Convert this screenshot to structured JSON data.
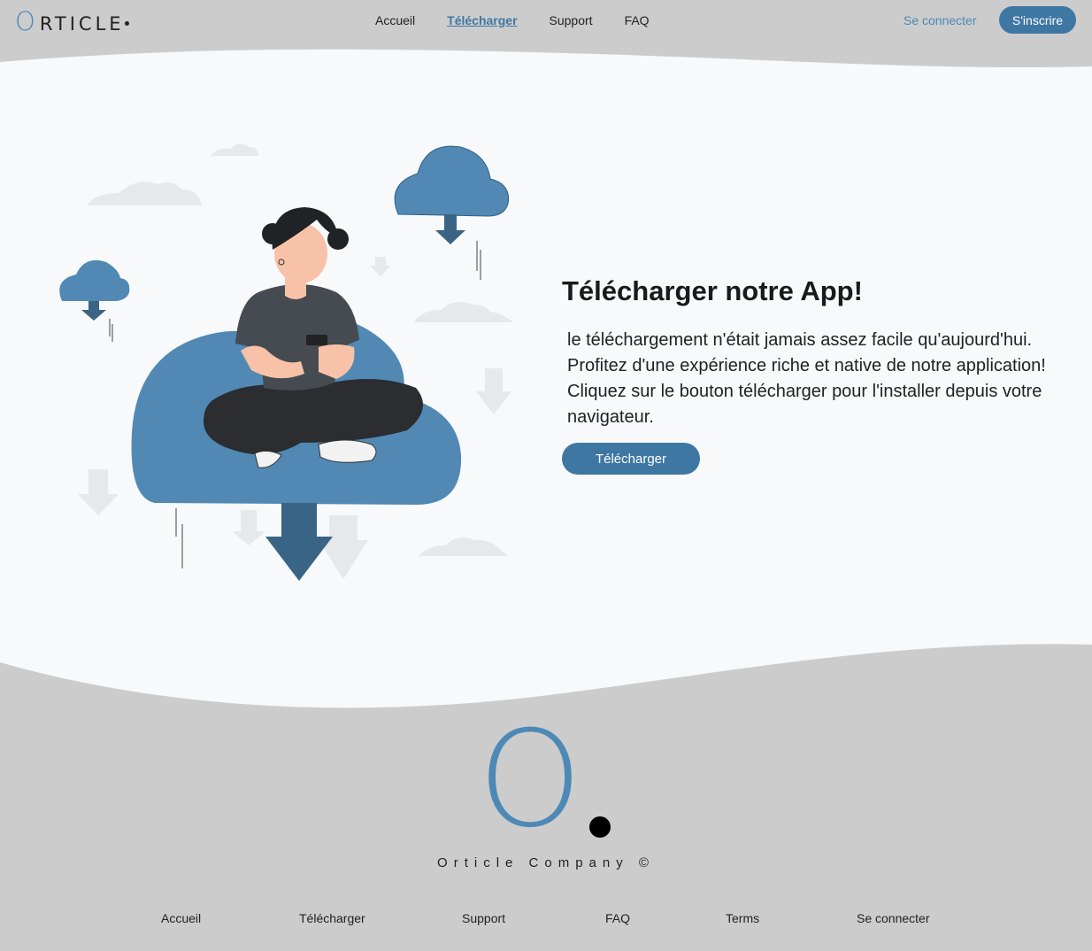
{
  "header": {
    "logo_initial": "O",
    "logo_rest": "RTICLE",
    "nav": [
      {
        "label": "Accueil",
        "active": false
      },
      {
        "label": "Télécharger",
        "active": true
      },
      {
        "label": "Support",
        "active": false
      },
      {
        "label": "FAQ",
        "active": false
      }
    ],
    "login_label": "Se connecter",
    "signup_label": "S'inscrire"
  },
  "hero": {
    "title": "Télécharger notre App!",
    "text": "le téléchargement n'était jamais assez facile qu'aujourd'hui. Profitez d'une expérience riche et native de notre application! Cliquez sur le bouton télécharger pour l'installer depuis votre navigateur.",
    "button_label": "Télécharger"
  },
  "footer": {
    "logo_initial": "O",
    "company": "Orticle Company ©",
    "links": [
      "Accueil",
      "Télécharger",
      "Support",
      "FAQ",
      "Terms",
      "Se connecter"
    ]
  },
  "colors": {
    "accent": "#3f77a3",
    "accent_light": "#4e89b5",
    "background": "#f7f9fa",
    "header_footer": "#cccccc"
  },
  "icons": [
    "cloud-download-icon",
    "arrow-down-icon",
    "cloud-icon"
  ]
}
